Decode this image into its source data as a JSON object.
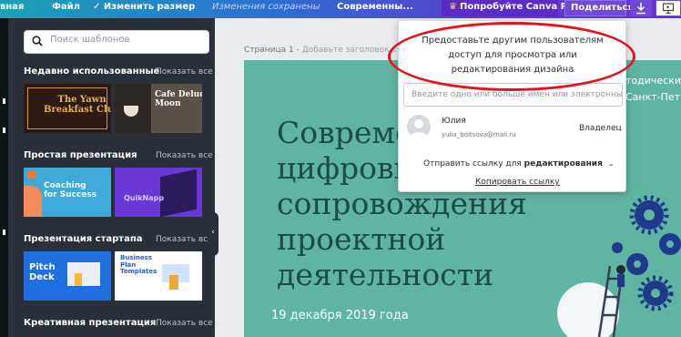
{
  "topbar": {
    "nav": "вная",
    "file": "Файл",
    "resize": "✓ Изменить размер",
    "saved": "Изменения сохранены",
    "doc_title": "Современны...",
    "pro": "Попробуйте Canva Pro",
    "share": "Поделиться",
    "download_icon": "download-icon",
    "present_icon": "present-icon"
  },
  "panel": {
    "search_placeholder": "Поиск шаблонов",
    "sections": [
      {
        "title": "Недавно использованные",
        "see_all": "Показать все",
        "thumbs": [
          {
            "text": "The Yawn\nBreakfast Club"
          },
          {
            "text": "Cafe Deluca\nMoon"
          }
        ]
      },
      {
        "title": "Простая презентация",
        "see_all": "Показать все",
        "thumbs": [
          {
            "text": "Coaching\nfor Success"
          },
          {
            "text": "QuikNapp"
          }
        ]
      },
      {
        "title": "Презентация стартапа",
        "see_all": "Показать все",
        "thumbs": [
          {
            "text": "Pitch\nDeck"
          },
          {
            "text": "Business\nPlan\nTemplates"
          }
        ]
      },
      {
        "title": "Креативная презентация",
        "see_all": "Показать все",
        "thumbs": []
      }
    ]
  },
  "page": {
    "label": "Страница 1 -",
    "hint": "Добавьте заголовок стр"
  },
  "slide": {
    "title": "Совреме\nцифрови\nсопровождения\nпроектной\nдеятельности",
    "date": "19 декабря 2019 года",
    "corner_text": "тодически\nСанкт-Пет"
  },
  "dialog": {
    "heading": "Предоставьте другим пользователям доступ для просмотра или редактирования дизайна",
    "input_placeholder": "Введите одно или больше имен или электронных адр",
    "user_name": "Юлия",
    "user_email": "yulia_boitsova@mail.ru",
    "user_role": "Владелец",
    "link_prefix": "Отправить ссылку для",
    "link_mode": "редактирования",
    "copy_link": "Копировать ссылку"
  },
  "colors": {
    "accent": "#6f49d9",
    "slide_bg": "#5fb5a1",
    "highlight": "#e8101a"
  }
}
